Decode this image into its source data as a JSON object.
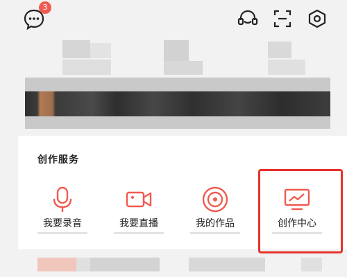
{
  "header": {
    "message_badge_count": "3",
    "icons": {
      "messages": "chat-bubble-icon",
      "customer_service": "headset-icon",
      "scan": "scan-icon",
      "settings": "settings-hexagon-icon"
    }
  },
  "services": {
    "title": "创作服务",
    "items": [
      {
        "label": "我要录音",
        "icon": "microphone-icon"
      },
      {
        "label": "我要直播",
        "icon": "video-camera-icon"
      },
      {
        "label": "我的作品",
        "icon": "disc-icon"
      },
      {
        "label": "创作中心",
        "icon": "chart-monitor-icon"
      }
    ],
    "highlighted_item": "创作中心"
  },
  "colors": {
    "accent": "#f05a4f",
    "highlight_border": "#e8322b",
    "background": "#f2f2f2",
    "card": "#ffffff"
  }
}
